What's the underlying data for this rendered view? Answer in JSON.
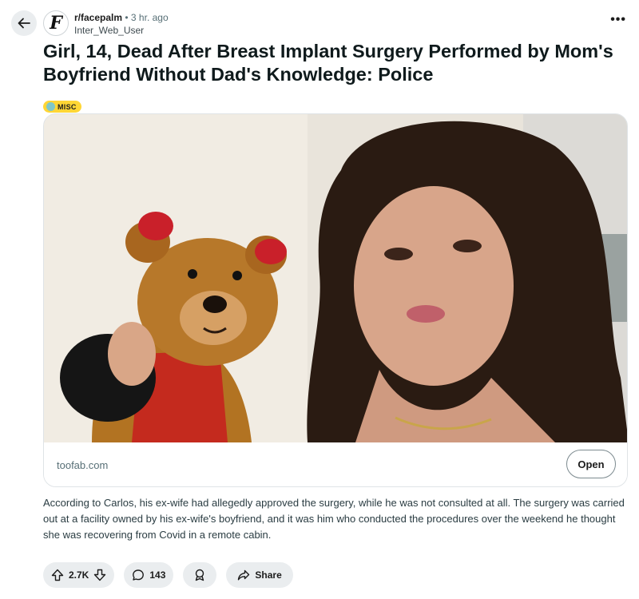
{
  "post": {
    "subreddit": "r/facepalm",
    "separator": "•",
    "time_ago": "3 hr. ago",
    "author": "Inter_Web_User",
    "subreddit_avatar_letter": "F",
    "title": "Girl, 14, Dead After Breast Implant Surgery Performed by Mom's Boyfriend Without Dad's Knowledge: Police",
    "flair": "MISC",
    "more_label": "•••",
    "body": "According to Carlos, his ex-wife had allegedly approved the surgery, while he was not consulted at all. The surgery was carried out at a facility owned by his ex-wife's boyfriend, and it was him who conducted the procedures over the weekend he thought she was recovering from Covid in a remote cabin."
  },
  "link_card": {
    "domain": "toofab.com",
    "open_label": "Open"
  },
  "actions": {
    "upvotes": "2.7K",
    "comments": "143",
    "share_label": "Share"
  },
  "colors": {
    "flair_bg": "#ffd635",
    "pill_bg": "#eaedef",
    "text": "#1c1c1c",
    "muted": "#576f76"
  },
  "icons": [
    "back-arrow-icon",
    "more-options-icon",
    "upvote-icon",
    "downvote-icon",
    "comment-icon",
    "award-icon",
    "share-icon"
  ]
}
